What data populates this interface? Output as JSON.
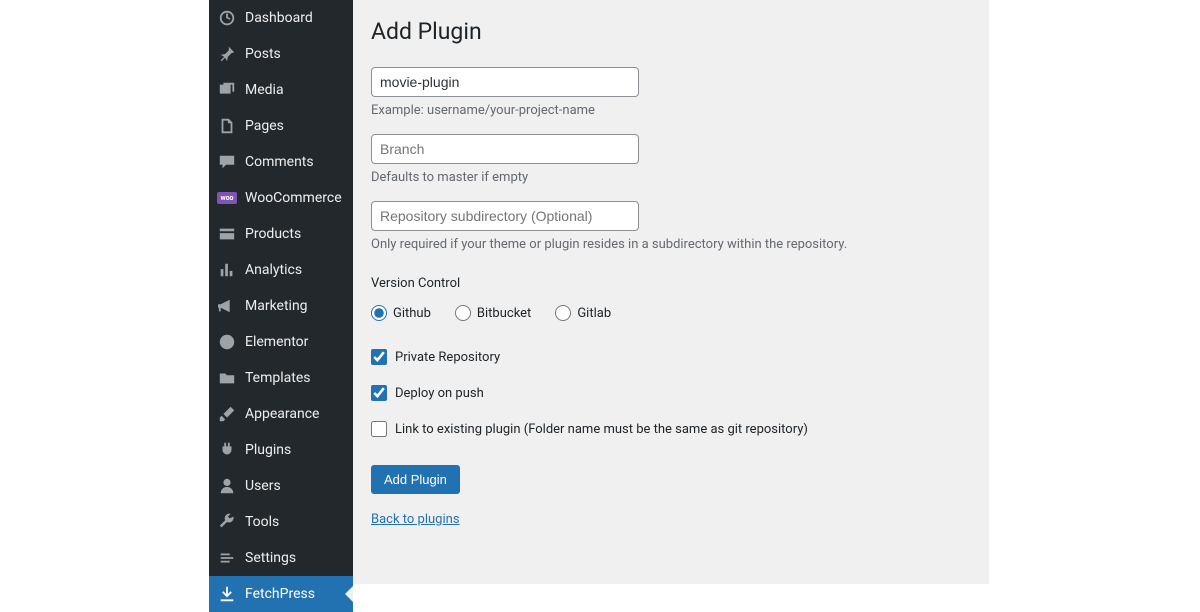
{
  "sidebar": {
    "items": [
      {
        "label": "Dashboard"
      },
      {
        "label": "Posts"
      },
      {
        "label": "Media"
      },
      {
        "label": "Pages"
      },
      {
        "label": "Comments"
      },
      {
        "label": "WooCommerce"
      },
      {
        "label": "Products"
      },
      {
        "label": "Analytics"
      },
      {
        "label": "Marketing"
      },
      {
        "label": "Elementor"
      },
      {
        "label": "Templates"
      },
      {
        "label": "Appearance"
      },
      {
        "label": "Plugins"
      },
      {
        "label": "Users"
      },
      {
        "label": "Tools"
      },
      {
        "label": "Settings"
      },
      {
        "label": "FetchPress"
      }
    ]
  },
  "page": {
    "title": "Add Plugin"
  },
  "form": {
    "repo_value": "movie-plugin",
    "repo_help": "Example: username/your-project-name",
    "branch_placeholder": "Branch",
    "branch_help": "Defaults to master if empty",
    "subdir_placeholder": "Repository subdirectory (Optional)",
    "subdir_help": "Only required if your theme or plugin resides in a subdirectory within the repository.",
    "vc_label": "Version Control",
    "vc_options": {
      "github": "Github",
      "bitbucket": "Bitbucket",
      "gitlab": "Gitlab"
    },
    "check_private": "Private Repository",
    "check_deploy": "Deploy on push",
    "check_link": "Link to existing plugin (Folder name must be the same as git repository)",
    "submit_label": "Add Plugin",
    "back_label": "Back to plugins"
  }
}
